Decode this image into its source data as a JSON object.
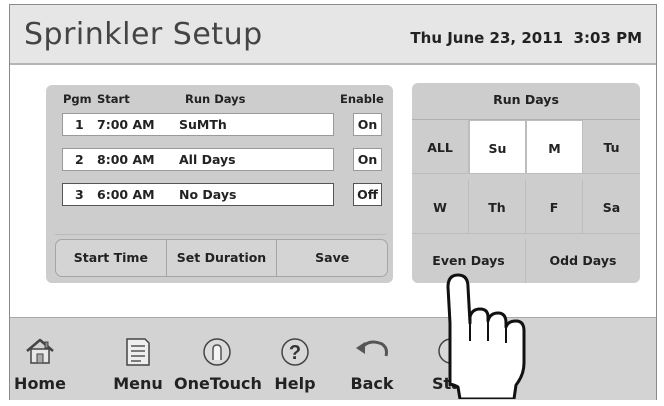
{
  "header": {
    "title": "Sprinkler Setup",
    "datetime": "Thu June 23, 2011  3:03 PM"
  },
  "programs": {
    "columns": {
      "pgm": "Pgm",
      "start": "Start",
      "run_days": "Run Days",
      "enable": "Enable"
    },
    "rows": [
      {
        "pgm": "1",
        "start": "7:00 AM",
        "run_days": "SuMTh",
        "enable": "On"
      },
      {
        "pgm": "2",
        "start": "8:00 AM",
        "run_days": "All Days",
        "enable": "On"
      },
      {
        "pgm": "3",
        "start": "6:00 AM",
        "run_days": "No Days",
        "enable": "Off"
      }
    ],
    "selected_row": 3,
    "actions": {
      "start_time": "Start Time",
      "set_duration": "Set Duration",
      "save": "Save"
    }
  },
  "run_days": {
    "title": "Run Days",
    "days": [
      {
        "label": "ALL",
        "selected": false
      },
      {
        "label": "Su",
        "selected": true
      },
      {
        "label": "M",
        "selected": true
      },
      {
        "label": "Tu",
        "selected": false
      },
      {
        "label": "W",
        "selected": false
      },
      {
        "label": "Th",
        "selected": true
      },
      {
        "label": "F",
        "selected": false
      },
      {
        "label": "Sa",
        "selected": false
      }
    ],
    "even_days": "Even Days",
    "odd_days": "Odd Days"
  },
  "nav": {
    "items": [
      {
        "label": "Home",
        "icon": "home-icon"
      },
      {
        "label": "Menu",
        "icon": "menu-icon"
      },
      {
        "label": "OneTouch",
        "icon": "onetouch-icon"
      },
      {
        "label": "Help",
        "icon": "help-icon"
      },
      {
        "label": "Back",
        "icon": "back-icon"
      },
      {
        "label": "Sta",
        "icon": "status-icon"
      }
    ]
  },
  "colors": {
    "panel": "#cdcdcd",
    "header": "#e6e6e6",
    "selected_day": "#ffffff",
    "navbar": "#d3d3d3"
  }
}
